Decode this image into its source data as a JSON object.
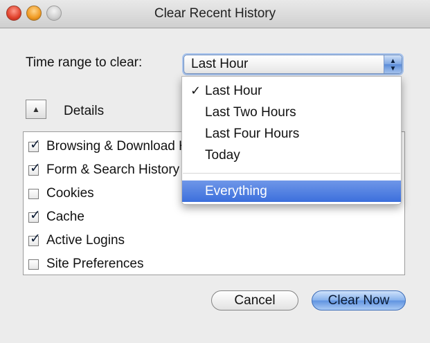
{
  "window": {
    "title": "Clear Recent History"
  },
  "time_range": {
    "label": "Time range to clear:",
    "selected": "Last Hour",
    "options": [
      {
        "label": "Last Hour",
        "checked": true
      },
      {
        "label": "Last Two Hours",
        "checked": false
      },
      {
        "label": "Last Four Hours",
        "checked": false
      },
      {
        "label": "Today",
        "checked": false
      },
      {
        "label": "Everything",
        "checked": false,
        "highlighted": true
      }
    ],
    "check_glyph": "✓"
  },
  "details": {
    "toggle_glyph": "▲",
    "label": "Details",
    "items": [
      {
        "label": "Browsing & Download History",
        "checked": true
      },
      {
        "label": "Form & Search History",
        "checked": true
      },
      {
        "label": "Cookies",
        "checked": false
      },
      {
        "label": "Cache",
        "checked": true
      },
      {
        "label": "Active Logins",
        "checked": true
      },
      {
        "label": "Site Preferences",
        "checked": false
      }
    ],
    "check_glyph": "✓"
  },
  "buttons": {
    "cancel": "Cancel",
    "clear_now": "Clear Now"
  },
  "colors": {
    "accent": "#3c6fdc",
    "focus_ring": "#a9c4ec"
  }
}
